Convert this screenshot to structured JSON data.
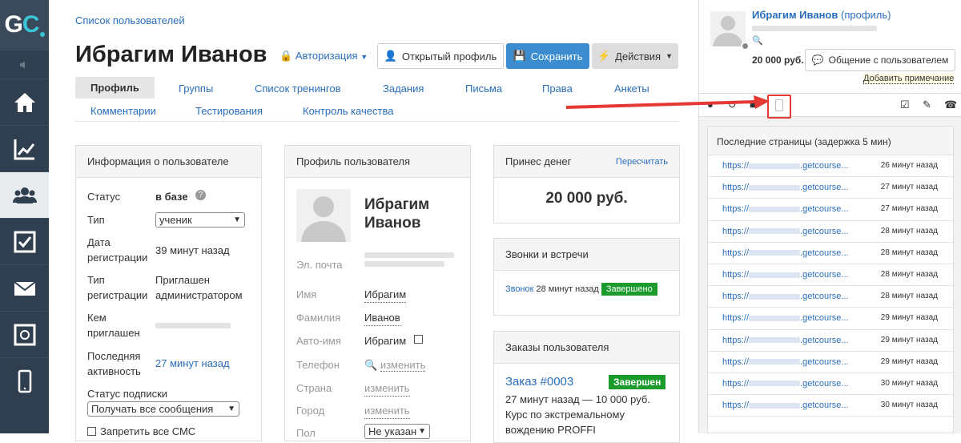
{
  "sidebar": {
    "logo_main": "G",
    "logo_accent": "C"
  },
  "main": {
    "breadcrumb": "Список пользователей",
    "title": "Ибрагим Иванов",
    "auth_label": "Авторизация",
    "btn_open": "Открытый профиль",
    "btn_save": "Сохранить",
    "btn_actions": "Действия",
    "tabs": [
      "Профиль",
      "Группы",
      "Список тренингов",
      "Задания",
      "Письма",
      "Права",
      "Анкеты",
      "Комментарии",
      "Тестирования",
      "Контроль качества"
    ]
  },
  "info": {
    "header": "Информация о пользователе",
    "status_label": "Статус",
    "status_value": "в базе",
    "type_label": "Тип",
    "type_value": "ученик",
    "reg_date_label1": "Дата",
    "reg_date_label2": "регистрации",
    "reg_date_value": "39 минут назад",
    "reg_type_label1": "Тип",
    "reg_type_label2": "регистрации",
    "reg_type_value1": "Приглашен",
    "reg_type_value2": "администратором",
    "invited_label1": "Кем",
    "invited_label2": "приглашен",
    "last_active_label1": "Последняя",
    "last_active_label2": "активность",
    "last_active_value": "27 минут назад",
    "sub_status_label": "Статус подписки",
    "sub_status_value": "Получать все сообщения",
    "sms_label": "Запретить все СМС"
  },
  "profile": {
    "header": "Профиль пользователя",
    "name1": "Ибрагим",
    "name2": "Иванов",
    "email_label": "Эл. почта",
    "first_name_label": "Имя",
    "first_name_value": "Ибрагим",
    "last_name_label": "Фамилия",
    "last_name_value": "Иванов",
    "autoname_label": "Авто-имя",
    "autoname_value": "Ибрагим",
    "phone_label": "Телефон",
    "change": "изменить",
    "country_label": "Страна",
    "city_label": "Город",
    "sex_label": "Пол",
    "sex_value": "Не указан"
  },
  "money": {
    "header": "Принес денег",
    "recalc": "Пересчитать",
    "amount": "20 000 руб."
  },
  "calls": {
    "header": "Звонки и встречи",
    "call_link": "Звонок",
    "call_time": "28 минут назад",
    "call_status": "Завершено"
  },
  "orders": {
    "header": "Заказы пользователя",
    "order_link": "Заказ #0003",
    "order_status": "Завершен",
    "order_line1": "27 минут назад — 10 000 руб.",
    "order_line2": "Курс по экстремальному",
    "order_line3": "вождению PROFFI"
  },
  "right": {
    "user_name": "Ибрагим Иванов",
    "profile_suffix": "(профиль)",
    "amount": "20 000 руб.",
    "chat_btn": "Общение с пользователем",
    "add_note": "Добавить примечание",
    "recent_header": "Последние страницы (задержка 5 мин)",
    "pages": [
      {
        "url_a": "https://",
        "url_b": ".getcourse...",
        "time": "26 минут назад"
      },
      {
        "url_a": "https://",
        "url_b": ".getcourse...",
        "time": "27 минут назад"
      },
      {
        "url_a": "https://",
        "url_b": ".getcourse...",
        "time": "27 минут назад"
      },
      {
        "url_a": "https://",
        "url_b": ".getcourse...",
        "time": "28 минут назад"
      },
      {
        "url_a": "https://",
        "url_b": ".getcourse...",
        "time": "28 минут назад"
      },
      {
        "url_a": "https://",
        "url_b": ".getcourse...",
        "time": "28 минут назад"
      },
      {
        "url_a": "https://",
        "url_b": ".getcourse...",
        "time": "28 минут назад"
      },
      {
        "url_a": "https://",
        "url_b": ".getcourse...",
        "time": "29 минут назад"
      },
      {
        "url_a": "https://",
        "url_b": ".getcourse...",
        "time": "29 минут назад"
      },
      {
        "url_a": "https://",
        "url_b": ".getcourse...",
        "time": "29 минут назад"
      },
      {
        "url_a": "https://",
        "url_b": ".getcourse...",
        "time": "30 минут назад"
      },
      {
        "url_a": "https://",
        "url_b": ".getcourse...",
        "time": "30 минут назад"
      }
    ]
  },
  "colors": {
    "accent": "#2a6ebb",
    "save": "#3c8dcf",
    "success": "#1a9b2c",
    "sidebar": "#2f3f4f",
    "arrow": "#e53935"
  }
}
